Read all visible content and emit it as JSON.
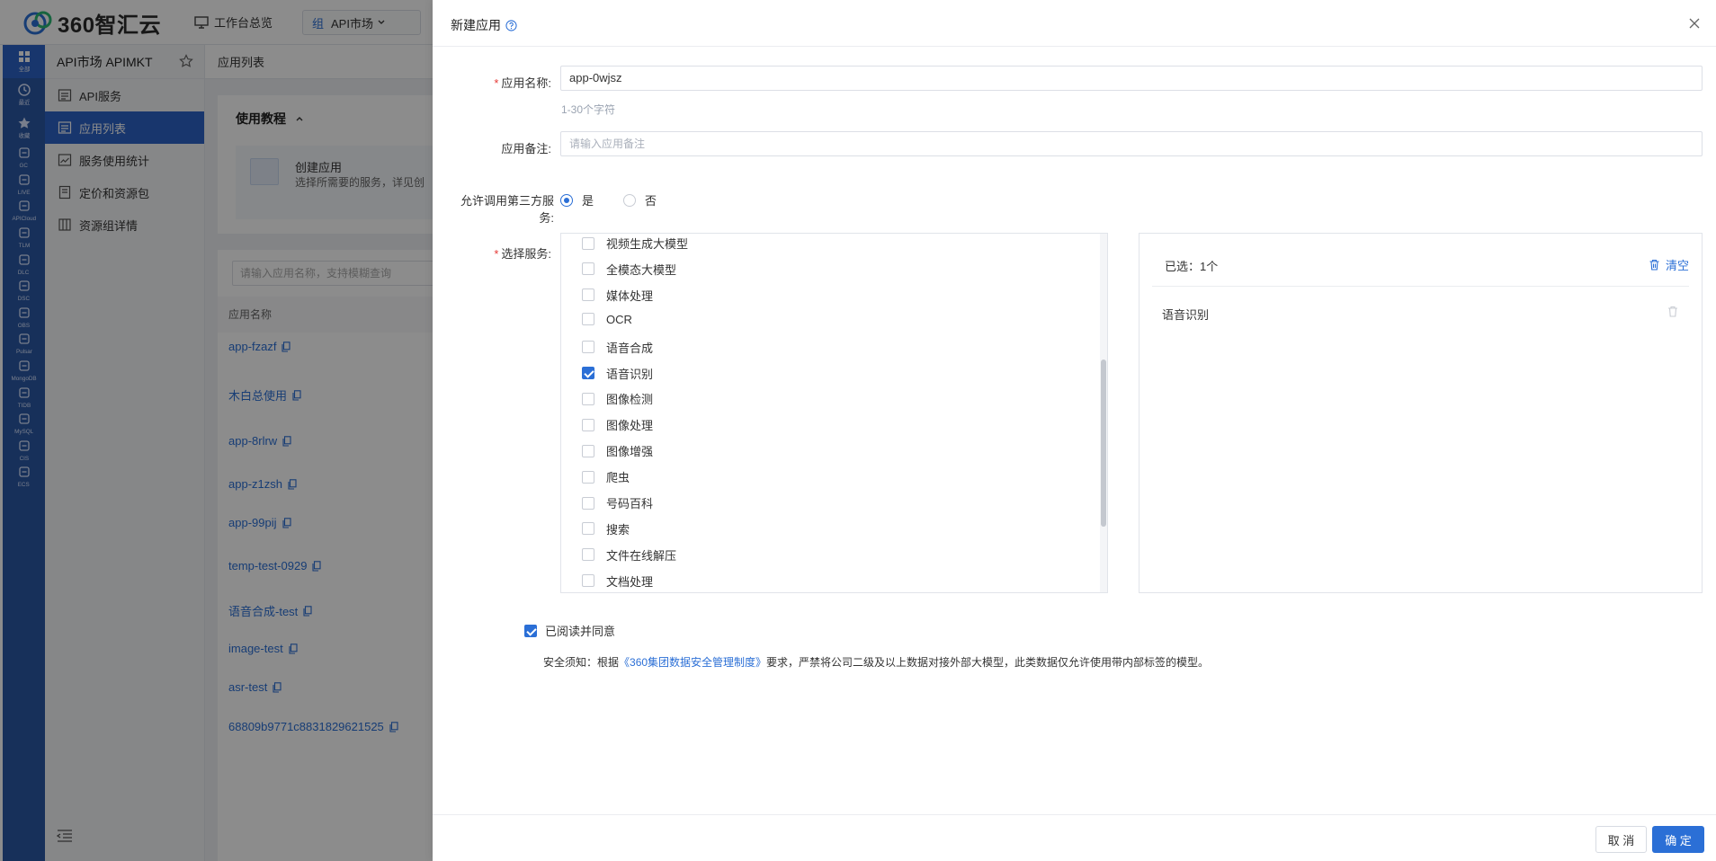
{
  "topbar": {
    "brand": "360智汇云",
    "workbench_label": "工作台总览",
    "market_group": "组",
    "market_label": "API市场"
  },
  "rail": [
    {
      "label": "全部",
      "icon": "grid-icon"
    },
    {
      "label": "最近",
      "icon": "recent-icon"
    },
    {
      "label": "收藏",
      "icon": "star-icon"
    },
    {
      "label": "GC",
      "icon": "cloud-icon"
    },
    {
      "label": "LIVE",
      "icon": "play-icon"
    },
    {
      "label": "APICloud",
      "icon": "api-cloud-icon"
    },
    {
      "label": "TLM",
      "icon": "gear-icon"
    },
    {
      "label": "DLC",
      "icon": "chart-icon"
    },
    {
      "label": "DSC",
      "icon": "dsc-icon"
    },
    {
      "label": "OBS",
      "icon": "storage-icon"
    },
    {
      "label": "Pulsar",
      "icon": "pulsar-icon"
    },
    {
      "label": "MongoDB",
      "icon": "mongodb-icon"
    },
    {
      "label": "TIDB",
      "icon": "tidb-icon"
    },
    {
      "label": "MySQL",
      "icon": "mysql-icon"
    },
    {
      "label": "CIS",
      "icon": "cis-icon"
    },
    {
      "label": "ECS",
      "icon": "ecs-icon"
    }
  ],
  "modnav": {
    "title": "API市场 APIMKT",
    "items": [
      {
        "label": "API服务"
      },
      {
        "label": "应用列表"
      },
      {
        "label": "服务使用统计"
      },
      {
        "label": "定价和资源包"
      },
      {
        "label": "资源组详情"
      }
    ]
  },
  "main": {
    "breadcrumb": "应用列表",
    "tutorial_title": "使用教程",
    "tutorial_step": "创建应用",
    "tutorial_desc": "选择所需要的服务，详见创",
    "search_placeholder": "请输入应用名称，支持模糊查询",
    "column_app_name": "应用名称",
    "apps": [
      "app-fzazf",
      "木白总使用",
      "app-8rlrw",
      "app-z1zsh",
      "app-99pij",
      "temp-test-0929",
      "语音合成-test",
      "image-test",
      "asr-test",
      "68809b9771c8831829621525"
    ]
  },
  "drawer": {
    "title": "新建应用",
    "app_name_label": "应用名称:",
    "app_name_value": "app-0wjsz",
    "app_name_hint": "1-30个字符",
    "remark_label": "应用备注:",
    "remark_placeholder": "请输入应用备注",
    "third_party_label": "允许调用第三方服务:",
    "radio_yes": "是",
    "radio_no": "否",
    "services_label": "选择服务:",
    "services": [
      {
        "label": "视频生成大模型",
        "checked": false
      },
      {
        "label": "全模态大模型",
        "checked": false
      },
      {
        "label": "媒体处理",
        "checked": false
      },
      {
        "label": "OCR",
        "checked": false
      },
      {
        "label": "语音合成",
        "checked": false
      },
      {
        "label": "语音识别",
        "checked": true
      },
      {
        "label": "图像检测",
        "checked": false
      },
      {
        "label": "图像处理",
        "checked": false
      },
      {
        "label": "图像增强",
        "checked": false
      },
      {
        "label": "爬虫",
        "checked": false
      },
      {
        "label": "号码百科",
        "checked": false
      },
      {
        "label": "搜索",
        "checked": false
      },
      {
        "label": "文件在线解压",
        "checked": false
      },
      {
        "label": "文档处理",
        "checked": false
      }
    ],
    "selected_count": "已选：1个",
    "clear_label": "清空",
    "selected_items": [
      "语音识别"
    ],
    "agree_label": "已阅读并同意",
    "notice_prefix": "安全须知：根据",
    "notice_link": "《360集团数据安全管理制度》",
    "notice_suffix": "要求，严禁将公司二级及以上数据对接外部大模型，此类数据仅允许使用带内部标签的模型。",
    "cancel_label": "取 消",
    "ok_label": "确 定"
  },
  "colors": {
    "accent": "#2b6fd6",
    "rail_bg": "#2b58a5",
    "required": "#e53935"
  }
}
